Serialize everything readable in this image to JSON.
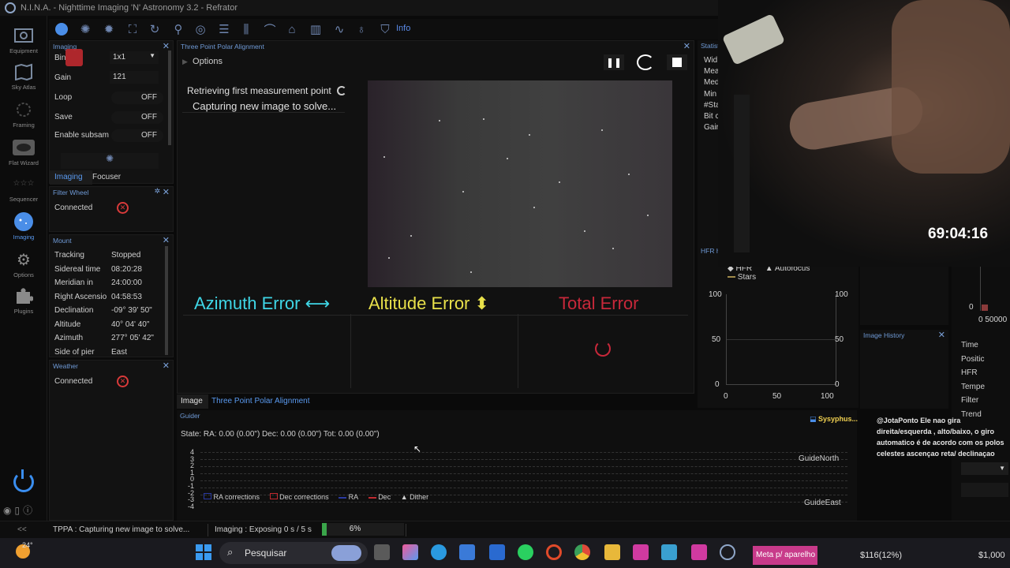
{
  "app": {
    "title": "N.I.N.A. - Nighttime Imaging 'N' Astronomy 3.2   -   Refrator"
  },
  "sidebar": {
    "items": [
      {
        "label": "Equipment",
        "icon": "camera-icon"
      },
      {
        "label": "Sky Atlas",
        "icon": "atlas-icon"
      },
      {
        "label": "Framing",
        "icon": "framing-icon"
      },
      {
        "label": "Flat Wizard",
        "icon": "flat-wizard-icon"
      },
      {
        "label": "Sequencer",
        "icon": "sequencer-icon"
      },
      {
        "label": "Imaging",
        "icon": "imaging-icon"
      },
      {
        "label": "Options",
        "icon": "gear-icon"
      },
      {
        "label": "Plugins",
        "icon": "puzzle-icon"
      }
    ]
  },
  "toolbar": {
    "info_label": "Info"
  },
  "imaging_panel": {
    "title": "Imaging",
    "bin_label": "Bin",
    "bin_value": "1x1",
    "gain_label": "Gain",
    "gain_value": "121",
    "loop_label": "Loop",
    "loop_value": "OFF",
    "save_label": "Save",
    "save_value": "OFF",
    "subsam_label": "Enable subsam",
    "subsam_value": "OFF",
    "tabs": [
      "Imaging",
      "Focuser"
    ]
  },
  "filter_wheel": {
    "title": "Filter Wheel",
    "status": "Connected"
  },
  "mount": {
    "title": "Mount",
    "rows": [
      {
        "label": "Tracking",
        "value": "Stopped"
      },
      {
        "label": "Sidereal time",
        "value": "08:20:28"
      },
      {
        "label": "Meridian in",
        "value": "24:00:00"
      },
      {
        "label": "Right Ascensio",
        "value": "04:58:53"
      },
      {
        "label": "Declination",
        "value": "-09° 39' 50\""
      },
      {
        "label": "Altitude",
        "value": "40° 04' 40\""
      },
      {
        "label": "Azimuth",
        "value": "277° 05' 42\""
      },
      {
        "label": "Side of pier",
        "value": "East"
      }
    ]
  },
  "weather": {
    "title": "Weather",
    "status": "Connected"
  },
  "tppa": {
    "title": "Three Point Polar Alignment",
    "options_label": "Options",
    "status_line1": "Retrieving first measurement point",
    "status_line2": "Capturing new image to solve...",
    "azimuth_label": "Azimuth Error ⟷",
    "altitude_label": "Altitude Error ⬍",
    "total_label": "Total Error",
    "azimuth_color": "#3fd6e6",
    "altitude_color": "#e8e04a",
    "total_color": "#c8283a",
    "bottom_tabs": [
      "Image",
      "Three Point Polar Alignment"
    ]
  },
  "stats": {
    "title": "Statist",
    "rows": [
      "Wid",
      "Mea",
      "Med",
      "Min",
      "#Sta",
      "Bit c",
      "Gair"
    ]
  },
  "hfr": {
    "title": "HFR hi",
    "legend": [
      "HFR",
      "Autofocus",
      "Stars"
    ],
    "y_ticks": [
      "100",
      "50",
      "0"
    ],
    "x_ticks": [
      "0",
      "50",
      "100"
    ]
  },
  "image_history": {
    "title": "Image History"
  },
  "right_col": {
    "tick_zero": "0",
    "x_tick": "0 50000",
    "rows": [
      "Time",
      "Positic",
      "HFR",
      "Tempe",
      "Filter",
      "Trend"
    ]
  },
  "guider": {
    "title": "Guider",
    "state": "State:  RA: 0.00 (0.00\")  Dec: 0.00 (0.00\")  Tot: 0.00 (0.00\")",
    "y_ticks": [
      "4",
      "3",
      "2",
      "1",
      "0",
      "-1",
      "-2",
      "-3",
      "-4"
    ],
    "guide_north": "GuideNorth",
    "guide_east": "GuideEast",
    "legend": [
      "RA corrections",
      "Dec corrections",
      "RA",
      "Dec",
      "Dither"
    ]
  },
  "webcam": {
    "timer": "69:04:16"
  },
  "chat": {
    "user": "Sysyphus...",
    "message": "@JotaPonto Ele nao gira direita/esquerda , alto/baixo, o giro automatico é de acordo com os polos celestes ascençao reta/ declinaçao"
  },
  "statusbar": {
    "tppa_text": "TPPA :   Capturing new image to solve...",
    "imaging_text": "Imaging :   Exposing 0 s / 5 s",
    "progress_label": "6%",
    "progress_fraction": 0.06
  },
  "taskbar": {
    "weather_temp": "24°",
    "search_placeholder": "Pesquisar",
    "notification": "Meta p/ aparelho",
    "amount1": "$116(12%)",
    "amount2": "$1,000"
  }
}
